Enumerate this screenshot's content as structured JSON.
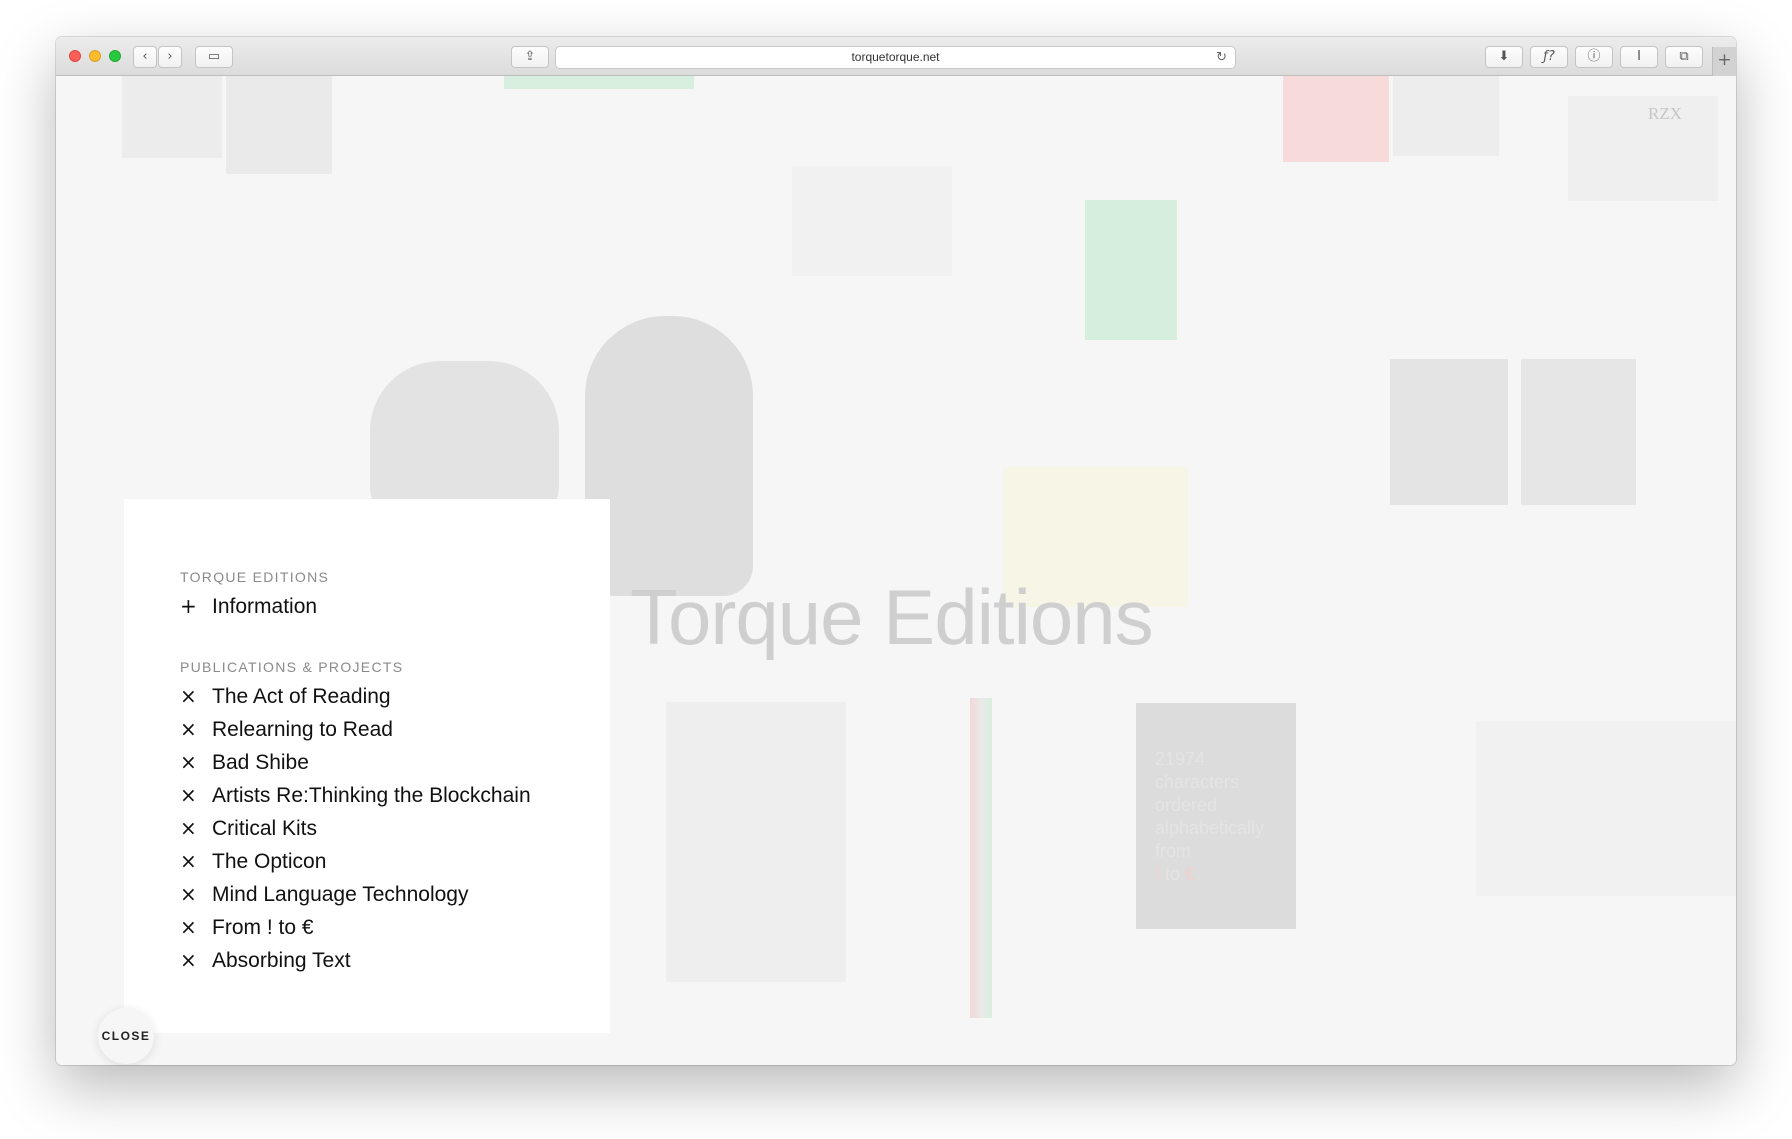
{
  "browser": {
    "url": "torquetorque.net",
    "reload_icon": "reload-icon",
    "new_tab_symbol": "+",
    "toolbar_icons": [
      "back-icon",
      "forward-icon",
      "sidebar-icon",
      "share-icon",
      "download-icon",
      "font-icon",
      "password-icon",
      "reader-icon",
      "tabs-icon"
    ]
  },
  "page": {
    "hero_title": "Torque Editions",
    "book_cover_text": [
      "21974",
      "characters",
      "ordered",
      "alphabetically",
      "from"
    ],
    "book_cover_last_line": {
      "a": "!",
      "b": " to ",
      "c": "€"
    },
    "corner_logo": "RZX"
  },
  "menu": {
    "section1_label": "TORQUE EDITIONS",
    "info_item": {
      "symbol": "+",
      "label": "Information"
    },
    "section2_label": "PUBLICATIONS & PROJECTS",
    "items": [
      {
        "symbol": "×",
        "label": "The Act of Reading"
      },
      {
        "symbol": "×",
        "label": "Relearning to Read"
      },
      {
        "symbol": "×",
        "label": "Bad Shibe"
      },
      {
        "symbol": "×",
        "label": "Artists Re:Thinking the Blockchain"
      },
      {
        "symbol": "×",
        "label": "Critical Kits"
      },
      {
        "symbol": "×",
        "label": "The Opticon"
      },
      {
        "symbol": "×",
        "label": "Mind Language Technology"
      },
      {
        "symbol": "×",
        "label": "From ! to €"
      },
      {
        "symbol": "×",
        "label": "Absorbing Text"
      }
    ],
    "close_label": "CLOSE"
  },
  "colors": {
    "accent_green": "#c9ecd3",
    "accent_red": "#f7d4d4"
  }
}
